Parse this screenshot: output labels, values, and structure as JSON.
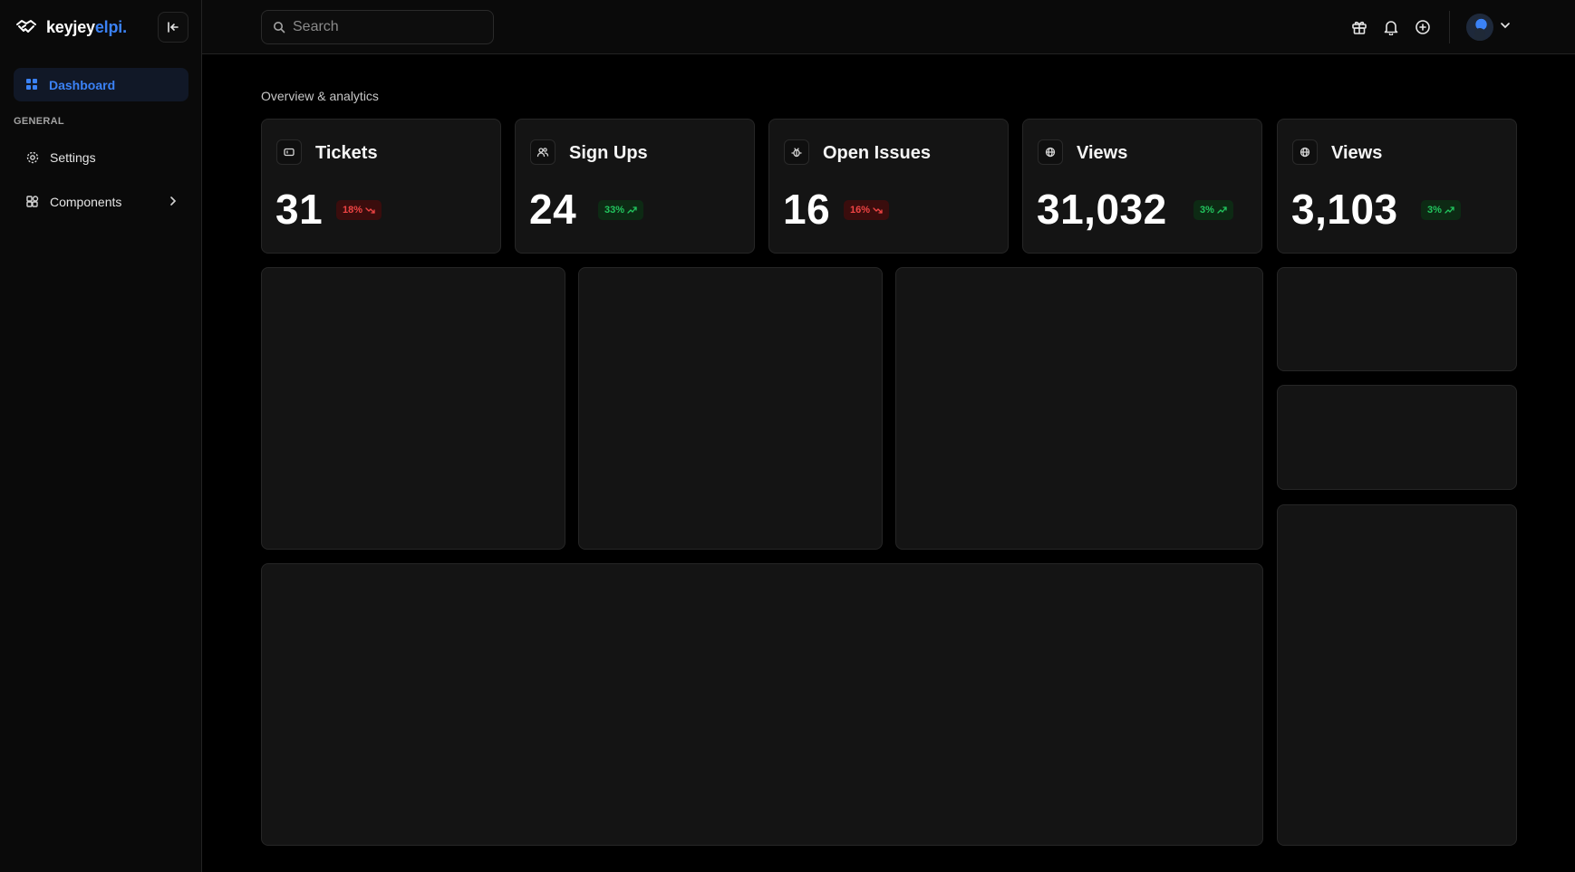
{
  "brand": {
    "name_main": "keyjey",
    "name_accent": "elpi."
  },
  "sidebar": {
    "active_item": {
      "label": "Dashboard",
      "icon": "grid-icon"
    },
    "section_label": "GENERAL",
    "items": [
      {
        "label": "Settings",
        "icon": "gear-icon"
      },
      {
        "label": "Components",
        "icon": "components-icon"
      }
    ]
  },
  "header": {
    "search_placeholder": "Search",
    "icons": [
      "gift-icon",
      "bell-icon",
      "plus-circle-icon",
      "avatar",
      "chevron-down-icon"
    ]
  },
  "main": {
    "subtitle": "Overview & analytics",
    "stats": [
      {
        "title": "Tickets",
        "value": "31",
        "change": "18%",
        "trend": "down",
        "icon": "ticket-icon"
      },
      {
        "title": "Sign Ups",
        "value": "24",
        "change": "33%",
        "trend": "up",
        "icon": "users-icon"
      },
      {
        "title": "Open Issues",
        "value": "16",
        "change": "16%",
        "trend": "down",
        "icon": "bug-icon"
      },
      {
        "title": "Views",
        "value": "31,032",
        "change": "3%",
        "trend": "up",
        "icon": "globe-icon"
      },
      {
        "title": "Views",
        "value": "3,103",
        "change": "3%",
        "trend": "up",
        "icon": "globe-icon"
      }
    ]
  },
  "colors": {
    "accent": "#3b82f6",
    "negative": "#ef4444",
    "positive": "#22c55e",
    "card_bg": "#141414",
    "border": "#262626"
  }
}
